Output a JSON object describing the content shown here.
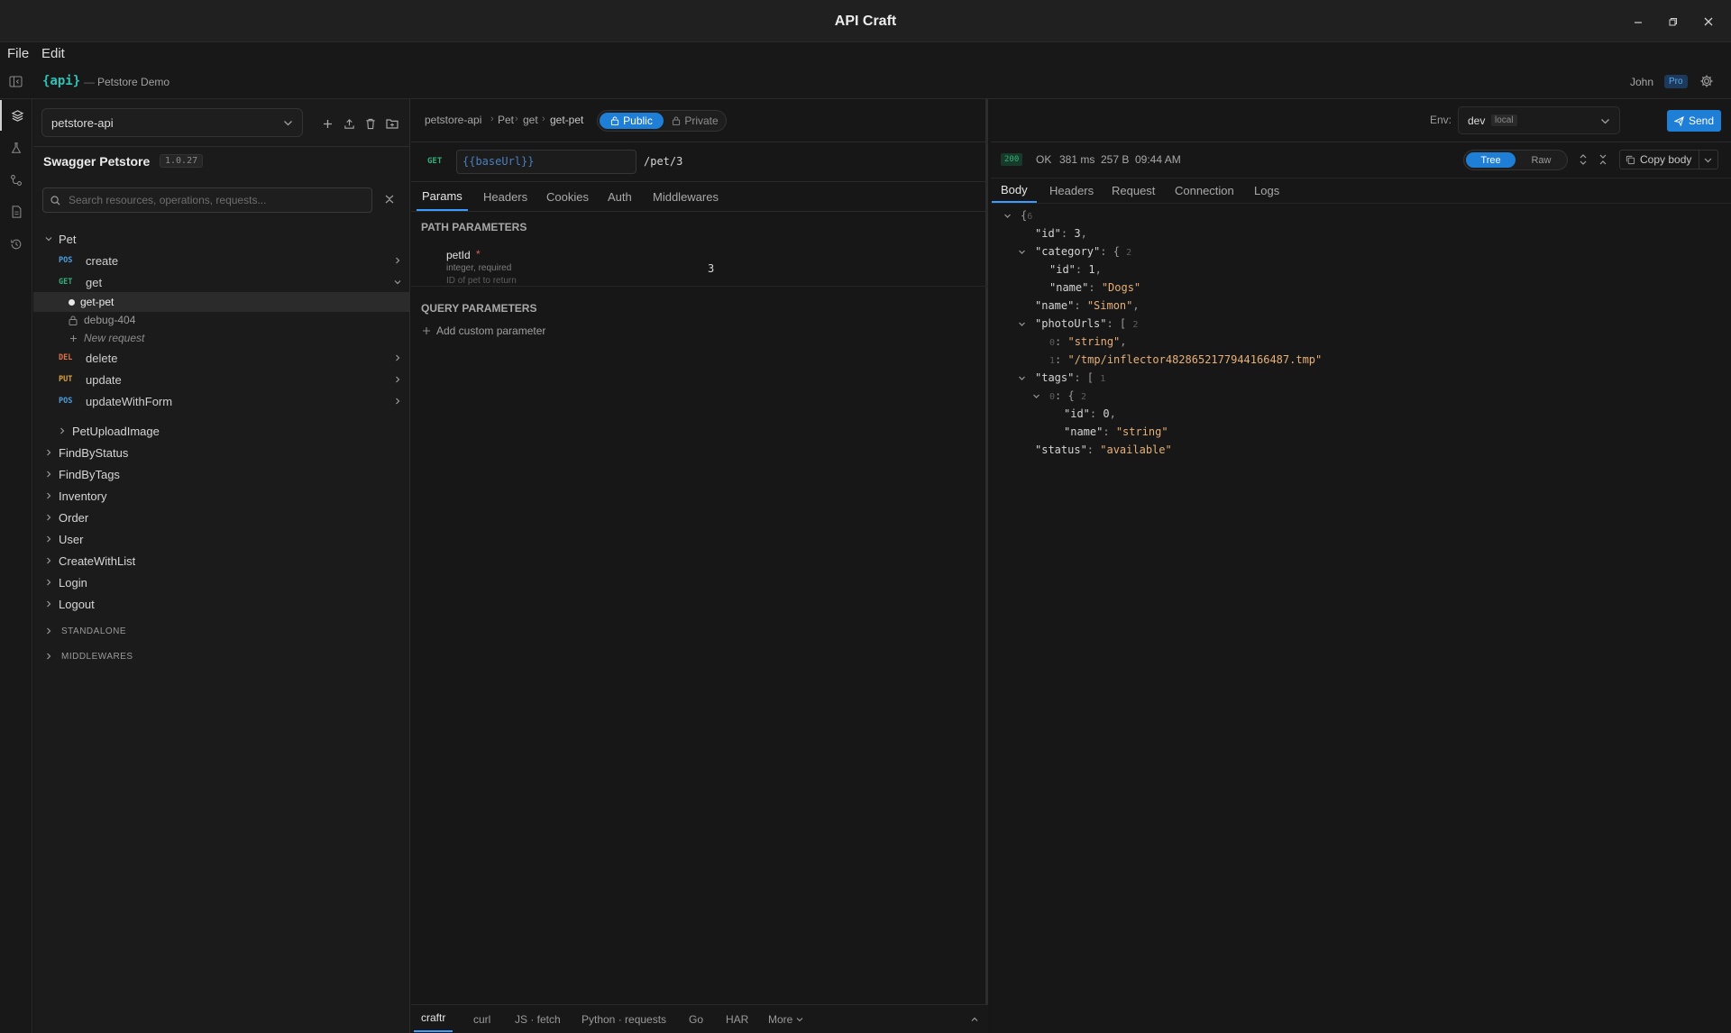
{
  "window": {
    "title": "API Craft"
  },
  "menu": {
    "file": "File",
    "edit": "Edit"
  },
  "header": {
    "logo": "{api}",
    "separator": "—",
    "project": "Petstore Demo",
    "user": "John",
    "plan_badge": "Pro"
  },
  "sidebar": {
    "spec_select": "petstore-api",
    "api_title": "Swagger Petstore",
    "api_version": "1.0.27",
    "search_placeholder": "Search resources, operations, requests...",
    "pet": {
      "label": "Pet",
      "operations": [
        {
          "method": "POS",
          "label": "create"
        },
        {
          "method": "GET",
          "label": "get"
        }
      ],
      "requests": [
        {
          "label": "get-pet"
        },
        {
          "label": "debug-404"
        }
      ],
      "new_request": "New request",
      "more_operations": [
        {
          "method": "DEL",
          "label": "delete"
        },
        {
          "method": "PUT",
          "label": "update"
        },
        {
          "method": "POS",
          "label": "updateWithForm"
        }
      ],
      "sub_resource": "PetUploadImage"
    },
    "resources": [
      "FindByStatus",
      "FindByTags",
      "Inventory",
      "Order",
      "User",
      "CreateWithList",
      "Login",
      "Logout"
    ],
    "sections": [
      "STANDALONE",
      "MIDDLEWARES"
    ]
  },
  "request": {
    "breadcrumb": [
      "petstore-api",
      "Pet",
      "get",
      "get-pet"
    ],
    "visibility": {
      "public": "Public",
      "private": "Private"
    },
    "method": "GET",
    "base_url": "{{baseUrl}}",
    "path": "/pet/3",
    "tabs": [
      "Params",
      "Headers",
      "Cookies",
      "Auth",
      "Middlewares"
    ],
    "path_params_title": "PATH PARAMETERS",
    "path_param": {
      "name": "petId",
      "required_mark": "*",
      "type": "integer, required",
      "description": "ID of pet to return",
      "value": "3"
    },
    "query_params_title": "QUERY PARAMETERS",
    "add_param": "Add custom parameter",
    "code_tabs": [
      "craftr",
      "curl",
      "JS · fetch",
      "Python · requests",
      "Go",
      "HAR",
      "More"
    ]
  },
  "env": {
    "label": "Env:",
    "name": "dev",
    "tag": "local"
  },
  "send_label": "Send",
  "response": {
    "status_code": "200",
    "status_text": "OK",
    "time": "381 ms",
    "size": "257 B",
    "timestamp": "09:44 AM",
    "view_tree": "Tree",
    "view_raw": "Raw",
    "copy_body": "Copy body",
    "tabs": [
      "Body",
      "Headers",
      "Request",
      "Connection",
      "Logs"
    ],
    "json_lines": [
      {
        "indent": 0,
        "toggle": true,
        "parts": [
          [
            "p",
            "{"
          ],
          [
            "c",
            "6"
          ]
        ]
      },
      {
        "indent": 1,
        "toggle": false,
        "parts": [
          [
            "k",
            "\"id\""
          ],
          [
            "p",
            ": "
          ],
          [
            "n",
            "3"
          ],
          [
            "p",
            ","
          ]
        ]
      },
      {
        "indent": 1,
        "toggle": true,
        "parts": [
          [
            "k",
            "\"category\""
          ],
          [
            "p",
            ": { "
          ],
          [
            "c",
            "2"
          ]
        ]
      },
      {
        "indent": 2,
        "toggle": false,
        "parts": [
          [
            "k",
            "\"id\""
          ],
          [
            "p",
            ": "
          ],
          [
            "n",
            "1"
          ],
          [
            "p",
            ","
          ]
        ]
      },
      {
        "indent": 2,
        "toggle": false,
        "parts": [
          [
            "k",
            "\"name\""
          ],
          [
            "p",
            ": "
          ],
          [
            "s",
            "\"Dogs\""
          ]
        ]
      },
      {
        "indent": 1,
        "toggle": false,
        "parts": [
          [
            "k",
            "\"name\""
          ],
          [
            "p",
            ": "
          ],
          [
            "s",
            "\"Simon\""
          ],
          [
            "p",
            ","
          ]
        ]
      },
      {
        "indent": 1,
        "toggle": true,
        "parts": [
          [
            "k",
            "\"photoUrls\""
          ],
          [
            "p",
            ": [ "
          ],
          [
            "c",
            "2"
          ]
        ]
      },
      {
        "indent": 2,
        "toggle": false,
        "parts": [
          [
            "c",
            "0"
          ],
          [
            "p",
            ": "
          ],
          [
            "s",
            "\"string\""
          ],
          [
            "p",
            ","
          ]
        ]
      },
      {
        "indent": 2,
        "toggle": false,
        "parts": [
          [
            "c",
            "1"
          ],
          [
            "p",
            ": "
          ],
          [
            "s",
            "\"/tmp/inflector4828652177944166487.tmp\""
          ]
        ]
      },
      {
        "indent": 1,
        "toggle": true,
        "parts": [
          [
            "k",
            "\"tags\""
          ],
          [
            "p",
            ": [ "
          ],
          [
            "c",
            "1"
          ]
        ]
      },
      {
        "indent": 2,
        "toggle": true,
        "parts": [
          [
            "c",
            "0"
          ],
          [
            "p",
            ": { "
          ],
          [
            "c",
            "2"
          ]
        ]
      },
      {
        "indent": 3,
        "toggle": false,
        "parts": [
          [
            "k",
            "\"id\""
          ],
          [
            "p",
            ": "
          ],
          [
            "n",
            "0"
          ],
          [
            "p",
            ","
          ]
        ]
      },
      {
        "indent": 3,
        "toggle": false,
        "parts": [
          [
            "k",
            "\"name\""
          ],
          [
            "p",
            ": "
          ],
          [
            "s",
            "\"string\""
          ]
        ]
      },
      {
        "indent": 1,
        "toggle": false,
        "parts": [
          [
            "k",
            "\"status\""
          ],
          [
            "p",
            ": "
          ],
          [
            "s",
            "\"available\""
          ]
        ]
      }
    ]
  }
}
